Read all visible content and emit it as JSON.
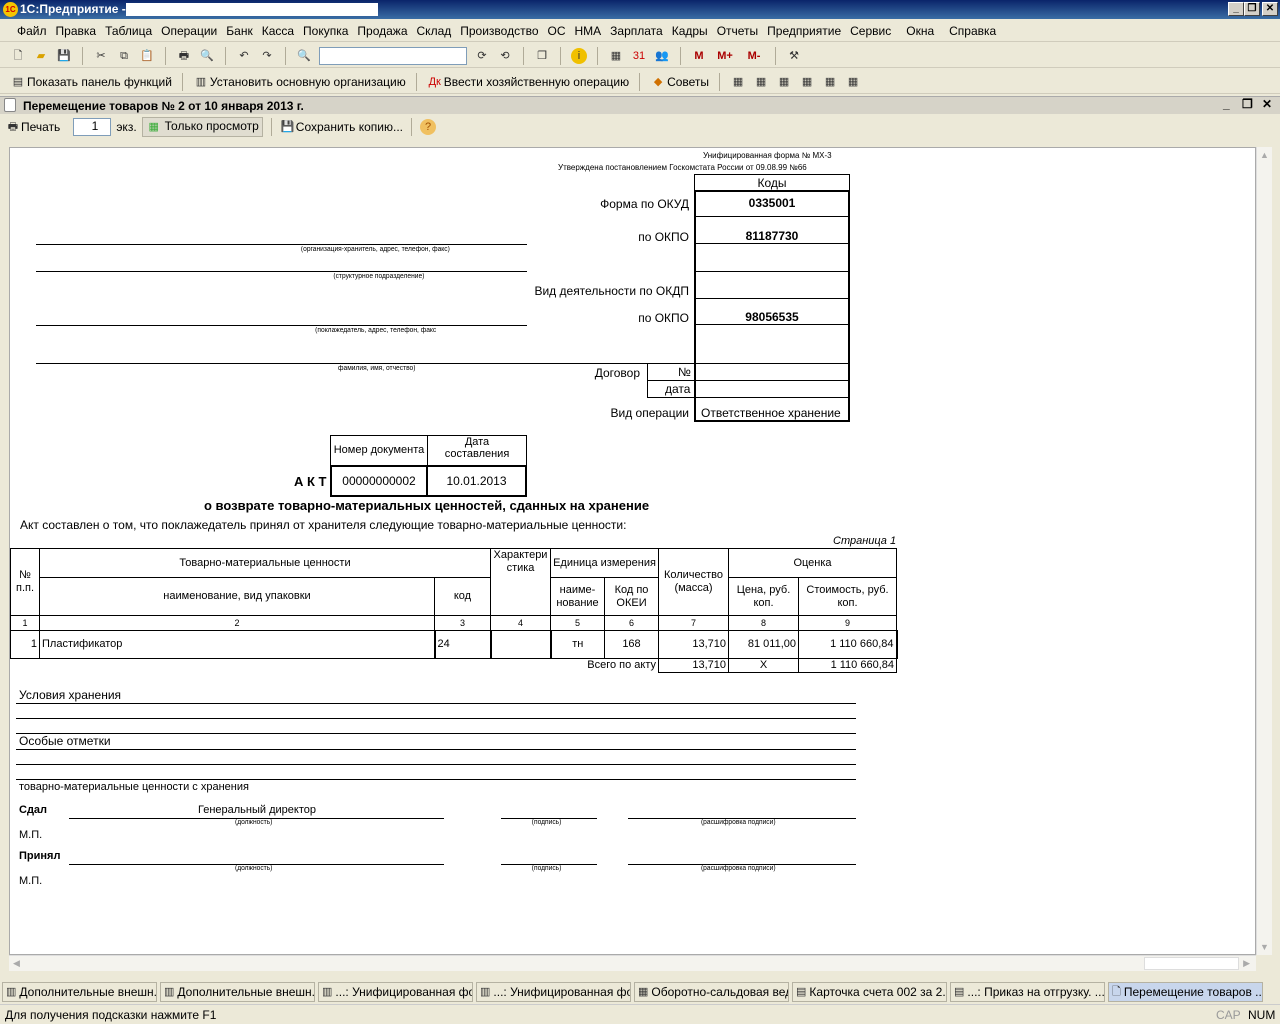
{
  "app": {
    "title": "1С:Предприятие - ",
    "logo": "1С"
  },
  "menu": [
    "Файл",
    "Правка",
    "Таблица",
    "Операции",
    "Банк",
    "Касса",
    "Покупка",
    "Продажа",
    "Склад",
    "Производство",
    "ОС",
    "НМА",
    "Зарплата",
    "Кадры",
    "Отчеты",
    "Предприятие",
    "Сервис",
    "Окна",
    "Справка"
  ],
  "toolbar2": {
    "show_panel": "Показать панель функций",
    "set_org": "Установить основную организацию",
    "enter_op": "Ввести хозяйственную операцию",
    "tips": "Советы"
  },
  "document": {
    "title": "Перемещение товаров № 2 от 10 января 2013 г.",
    "print": "Печать",
    "copies": "1",
    "copies_unit": "экз.",
    "view_only": "Только просмотр",
    "save_copy": "Сохранить копию..."
  },
  "form": {
    "unified": "Унифицированная форма № МХ-3",
    "approved": "Утверждена постановлением Госкомстата России от 09.08.99 №66",
    "codes_header": "Коды",
    "okud_label": "Форма по ОКУД",
    "okud": "0335001",
    "okpo_label": "по ОКПО",
    "okpo1": "81187730",
    "okdp_label": "Вид деятельности по ОКДП",
    "okpo2": "98056535",
    "contract_label": "Договор",
    "contract_no": "№",
    "contract_date": "дата",
    "op_label": "Вид операции",
    "op_value": "Ответственное хранение",
    "cap_org": "(организация-хранитель, адрес, телефон, факс)",
    "cap_dept": "(структурное подразделение)",
    "cap_depositor": "(поклажедатель, адрес, телефон, факс",
    "cap_fio": "фамилия, имя, отчество)",
    "docnum_label": "Номер документа",
    "docdate_label": "Дата составления",
    "act": "А К Т",
    "docnum": "00000000002",
    "docdate": "10.01.2013",
    "act_title": "о возврате товарно-материальных ценностей, сданных на хранение",
    "statement": "Акт составлен о том, что поклажедатель принял от хранителя следующие товарно-материальные ценности:",
    "page": "Страница 1",
    "table": {
      "h_num": "№ п.п.",
      "h_tmc": "Товарно-материальные ценности",
      "h_char": "Характери стика",
      "h_unit": "Единица измерения",
      "h_qty": "Количество (масса)",
      "h_eval": "Оценка",
      "h_name": "наименование, вид упаковки",
      "h_code": "код",
      "h_uname": "наиме- нование",
      "h_okei": "Код по ОКЕИ",
      "h_price": "Цена, руб. коп.",
      "h_cost": "Стоимость, руб. коп.",
      "colnums": [
        "1",
        "2",
        "3",
        "4",
        "5",
        "6",
        "7",
        "8",
        "9"
      ],
      "rows": [
        {
          "num": "1",
          "name": "Пластификатор",
          "code": "24",
          "char": "",
          "unit": "тн",
          "okei": "168",
          "qty": "13,710",
          "price": "81 011,00",
          "cost": "1 110 660,84"
        }
      ],
      "total_label": "Всего по акту",
      "total_qty": "13,710",
      "total_price": "X",
      "total_cost": "1 110 660,84"
    },
    "storage": "Условия хранения",
    "notes": "Особые отметки",
    "returned": "товарно-материальные ценности с хранения",
    "gave": "Сдал",
    "gave_position": "Генеральный директор",
    "received": "Принял",
    "mp": "М.П.",
    "cap_position": "(должность)",
    "cap_sign": "(подпись)",
    "cap_decode": "(расшифровка подписи)"
  },
  "taskbar": [
    "Дополнительные внешн...",
    "Дополнительные внешн...",
    "...: Унифицированная фо...",
    "...: Унифицированная фо...",
    "Оборотно-сальдовая вед...",
    "Карточка счета 002 за 2...",
    "...: Приказ на отгрузку. ...",
    "Перемещение товаров ..."
  ],
  "status": {
    "hint": "Для получения подсказки нажмите F1",
    "cap": "CAP",
    "num": "NUM"
  }
}
